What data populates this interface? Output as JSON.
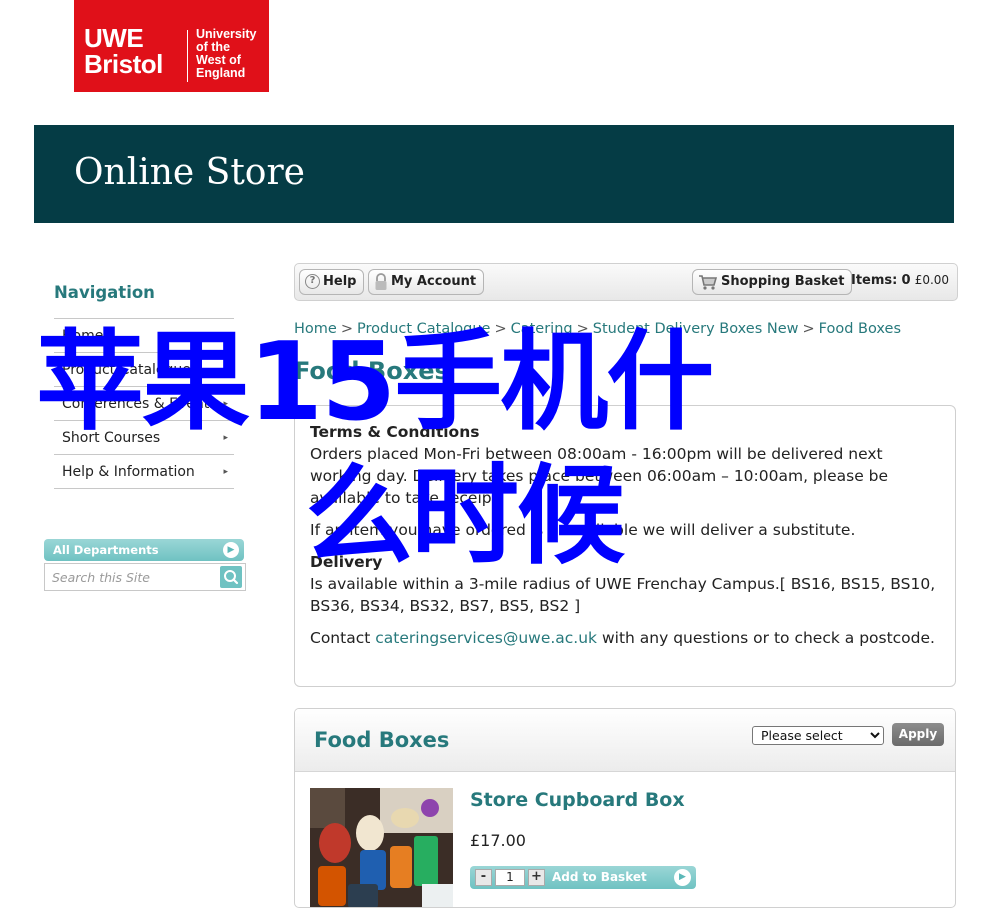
{
  "logo": {
    "mark_line1": "UWE",
    "mark_line2": "Bristol",
    "uni_line1": "University",
    "uni_line2": "of the",
    "uni_line3": "West of",
    "uni_line4": "England",
    "color": "#e01019"
  },
  "banner": {
    "title": "Online Store",
    "color": "#053c45"
  },
  "nav": {
    "heading": "Navigation",
    "items": [
      {
        "label": "Home",
        "has_submenu": false
      },
      {
        "label": "Product Catalogue",
        "has_submenu": true
      },
      {
        "label": "Conferences & Events",
        "has_submenu": true
      },
      {
        "label": "Short Courses",
        "has_submenu": true
      },
      {
        "label": "Help & Information",
        "has_submenu": true
      }
    ],
    "caret": "▸"
  },
  "departments": {
    "label": "All Departments",
    "arrow": "▶"
  },
  "search": {
    "placeholder": "Search this Site",
    "icon": "search-icon"
  },
  "toolbar": {
    "help_label": "Help",
    "account_label": "My Account",
    "basket_label": "Shopping Basket",
    "items_label": "Items:",
    "items_count": "0",
    "items_total": "£0.00"
  },
  "breadcrumb": {
    "items": [
      "Home",
      "Product Catalogue",
      "Catering",
      "Student Delivery Boxes New",
      "Food Boxes"
    ],
    "separator": ">"
  },
  "page": {
    "title": "Food Boxes"
  },
  "info": {
    "terms_heading": "Terms & Conditions",
    "terms_text": "Orders placed Mon-Fri between 08:00am - 16:00pm will be delivered next working day. Delivery takes place between 06:00am – 10:00am, please be available to take receipt.",
    "substitute_text": "If an item you have ordered is unavailable we will deliver a substitute.",
    "delivery_heading": "Delivery",
    "delivery_text": "Is available within a 3-mile radius of UWE Frenchay Campus.[ BS16, BS15, BS10, BS36, BS34, BS32, BS7, BS5, BS2 ]",
    "contact_prefix": "Contact",
    "contact_email": "cateringservices@uwe.ac.uk",
    "contact_suffix": "with any questions or to check a postcode."
  },
  "products_panel": {
    "title": "Food Boxes",
    "sort_selected": "Please select",
    "apply_label": "Apply"
  },
  "products": [
    {
      "name": "Store Cupboard Box",
      "price": "£17.00",
      "quantity": "1",
      "minus": "-",
      "plus": "+",
      "add_label": "Add to Basket"
    }
  ],
  "watermark": {
    "line1": "苹果15手机什",
    "line2": "么时候"
  },
  "accent_color": "#27797c"
}
